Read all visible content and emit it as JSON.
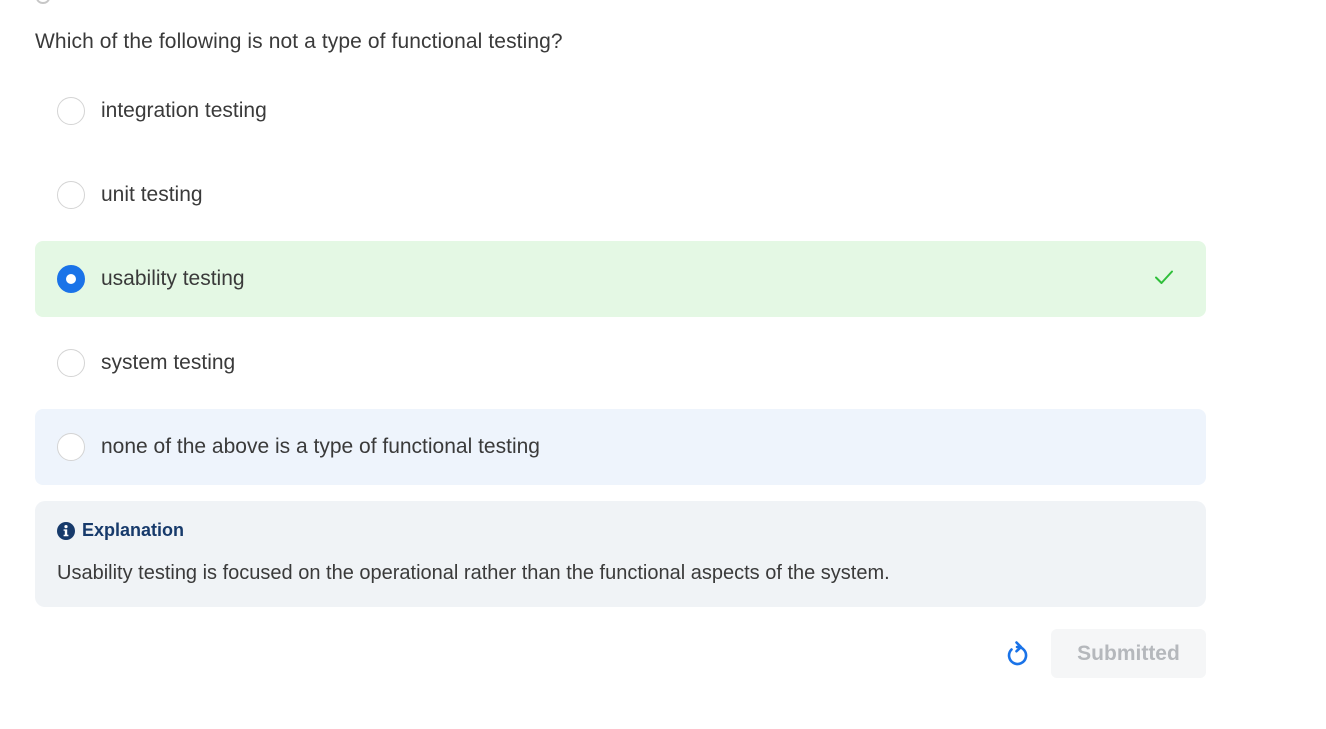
{
  "question": {
    "text": "Which of the following is not a type of functional testing?"
  },
  "options": [
    {
      "label": "integration testing",
      "selected": false,
      "state": "default"
    },
    {
      "label": "unit testing",
      "selected": false,
      "state": "default"
    },
    {
      "label": "usability testing",
      "selected": true,
      "state": "correct"
    },
    {
      "label": "system testing",
      "selected": false,
      "state": "default"
    },
    {
      "label": "none of the above is a type of functional testing",
      "selected": false,
      "state": "hover"
    }
  ],
  "explanation": {
    "icon": "info-icon",
    "title": "Explanation",
    "text": "Usability testing is focused on the operational rather than the functional aspects of the system."
  },
  "actions": {
    "retry_icon": "retry-icon",
    "submitted_label": "Submitted"
  },
  "colors": {
    "correct_background": "#e4f8e4",
    "hover_background": "#eef4fc",
    "selected_radio": "#1a73e8",
    "check_mark": "#2fbf3a",
    "explanation_background": "#f0f3f6",
    "explanation_title": "#173a6b"
  }
}
